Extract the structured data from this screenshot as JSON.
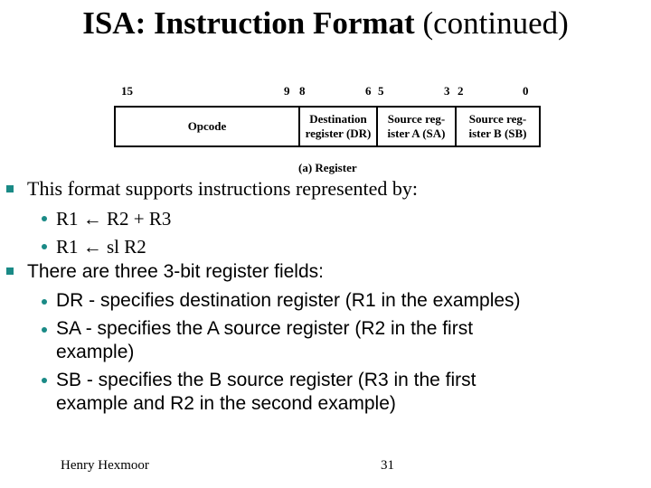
{
  "slide": {
    "title_bold": "ISA: Instruction Format",
    "title_normal": " (continued)"
  },
  "diagram": {
    "bit_labels": [
      "15",
      "9",
      "8",
      "6",
      "5",
      "3",
      "2",
      "0"
    ],
    "fields": [
      {
        "label": "Opcode",
        "bits": "15-9"
      },
      {
        "label": "Destination register (DR)",
        "line1": "Destination",
        "line2": "register (DR)",
        "bits": "8-6"
      },
      {
        "label": "Source register A (SA)",
        "line1": "Source reg-",
        "line2": "ister A (SA)",
        "bits": "5-3"
      },
      {
        "label": "Source register B (SB)",
        "line1": "Source reg-",
        "line2": "ister B (SB)",
        "bits": "2-0"
      }
    ],
    "caption": "(a) Register"
  },
  "bullets": [
    {
      "text": "This format supports instructions represented by:",
      "sub": [
        "R1 ← R2 + R3",
        "R1 ← sl R2"
      ]
    },
    {
      "text": "There are three 3-bit register fields:",
      "sub": [
        "DR - specifies destination register (R1 in the examples)",
        "SA - specifies the A source register (R2 in the first",
        "example)",
        "SB - specifies the B source register (R3 in the first",
        "example and R2 in the second example)"
      ]
    }
  ],
  "footer": {
    "author": "Henry Hexmoor",
    "page_number": "31"
  },
  "colors": {
    "bullet": "#1a8a86",
    "text": "#000000",
    "background": "#ffffff"
  }
}
